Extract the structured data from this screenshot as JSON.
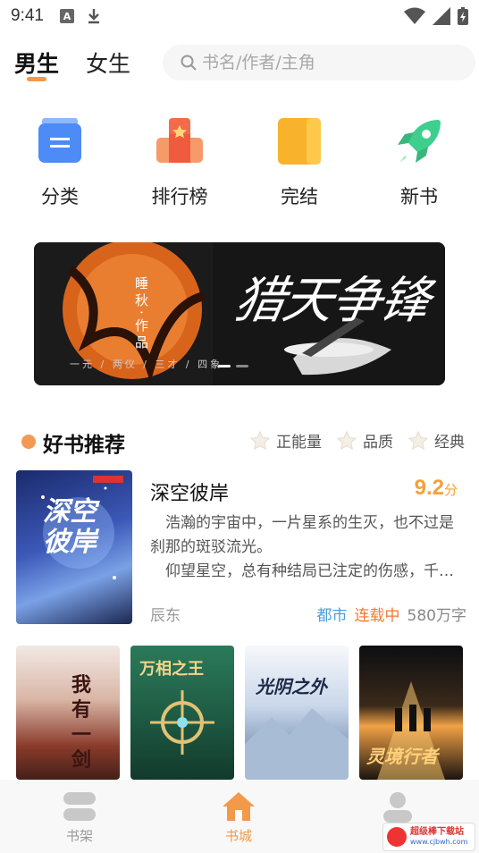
{
  "status": {
    "time": "9:41",
    "a_icon": "A"
  },
  "header": {
    "tabs": [
      {
        "label": "男生",
        "active": true
      },
      {
        "label": "女生",
        "active": false
      }
    ],
    "search_placeholder": "书名/作者/主角"
  },
  "categories": [
    {
      "label": "分类",
      "icon": "category-icon"
    },
    {
      "label": "排行榜",
      "icon": "ranking-icon"
    },
    {
      "label": "完结",
      "icon": "finished-icon"
    },
    {
      "label": "新书",
      "icon": "rocket-icon"
    }
  ],
  "banner": {
    "title": "猎天争锋",
    "author": "睡秋·作品",
    "motto": "一元 / 两仪 / 三才 / 四象",
    "page_count": 2,
    "active_page": 1
  },
  "recommend": {
    "title": "好书推荐",
    "filters": [
      "正能量",
      "品质",
      "经典"
    ],
    "featured": {
      "title": "深空彼岸",
      "score": "9.2",
      "score_unit": "分",
      "desc1": "浩瀚的宇宙中，一片星系的生灭，也不过是刹那的斑驳流光。",
      "desc2": "仰望星空，总有种结局已注定的伤感，千…",
      "author": "辰东",
      "genre": "都市",
      "status": "连载中",
      "words": "580万字",
      "cover_text": "深空彼岸"
    },
    "covers": [
      {
        "text": "我有一剑"
      },
      {
        "text": "万相之王"
      },
      {
        "text": "光阴之外"
      },
      {
        "text": "灵境行者"
      }
    ]
  },
  "tabbar": [
    {
      "label": "书架",
      "icon": "bookshelf-icon",
      "active": false
    },
    {
      "label": "书城",
      "icon": "home-icon",
      "active": true
    },
    {
      "label": "我的",
      "icon": "profile-icon",
      "active": false
    }
  ],
  "watermark": {
    "line1": "超级棒下载站",
    "line2": "www.cjbwh.com"
  },
  "colors": {
    "accent": "#f2994a",
    "score": "#f2a23c",
    "genre": "#4a9fe0",
    "status": "#f0792f"
  }
}
